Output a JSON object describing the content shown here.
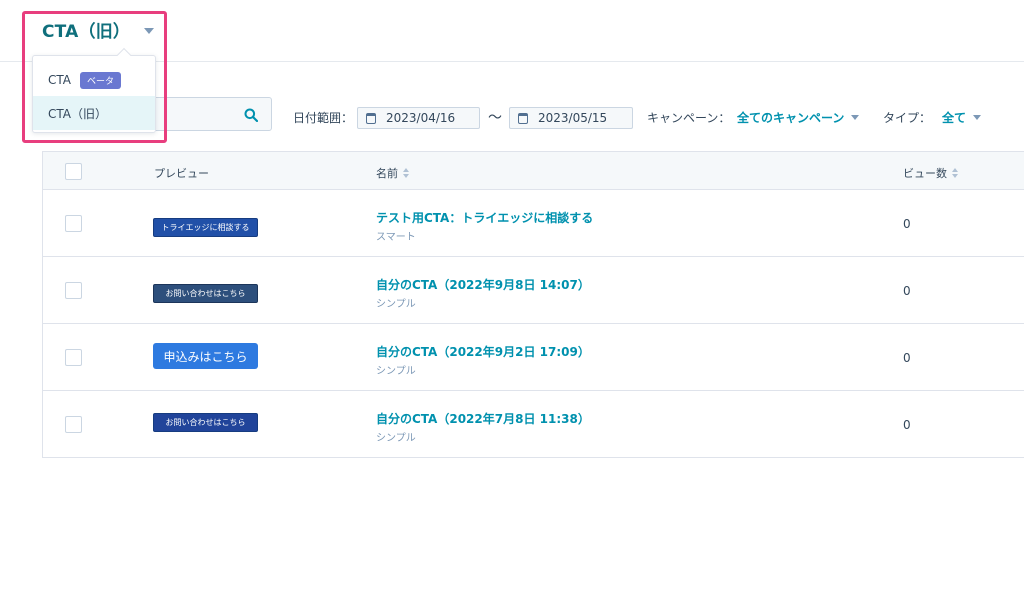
{
  "header": {
    "title": "CTA（旧）"
  },
  "menu": {
    "items": [
      {
        "label": "CTA",
        "badge": "ベータ"
      },
      {
        "label": "CTA（旧）"
      }
    ]
  },
  "filters": {
    "date_range_label": "日付範囲：",
    "date_from": "2023/04/16",
    "date_sep": "〜",
    "date_to": "2023/05/15",
    "campaign_label": "キャンペーン：",
    "campaign_value": "全てのキャンペーン",
    "type_label": "タイプ：",
    "type_value": "全て"
  },
  "table": {
    "columns": {
      "preview": "プレビュー",
      "name": "名前",
      "views": "ビュー数"
    },
    "rows": [
      {
        "preview": "トライエッジに相談する",
        "name": "テスト用CTA：トライエッジに相談する",
        "type": "スマート",
        "views": "0"
      },
      {
        "preview": "お問い合わせはこちら",
        "name": "自分のCTA（2022年9月8日 14:07）",
        "type": "シンプル",
        "views": "0"
      },
      {
        "preview": "申込みはこちら",
        "name": "自分のCTA（2022年9月2日 17:09）",
        "type": "シンプル",
        "views": "0"
      },
      {
        "preview": "お問い合わせはこちら",
        "name": "自分のCTA（2022年7月8日 11:38）",
        "type": "シンプル",
        "views": "0"
      }
    ]
  },
  "colors": {
    "accent": "#0091ae",
    "title": "#0f6f7c",
    "highlight": "#e83e7e",
    "beta_badge": "#6a78d1"
  },
  "icons": [
    "chevron-down-icon",
    "search-icon",
    "calendar-icon",
    "sort-icon"
  ]
}
